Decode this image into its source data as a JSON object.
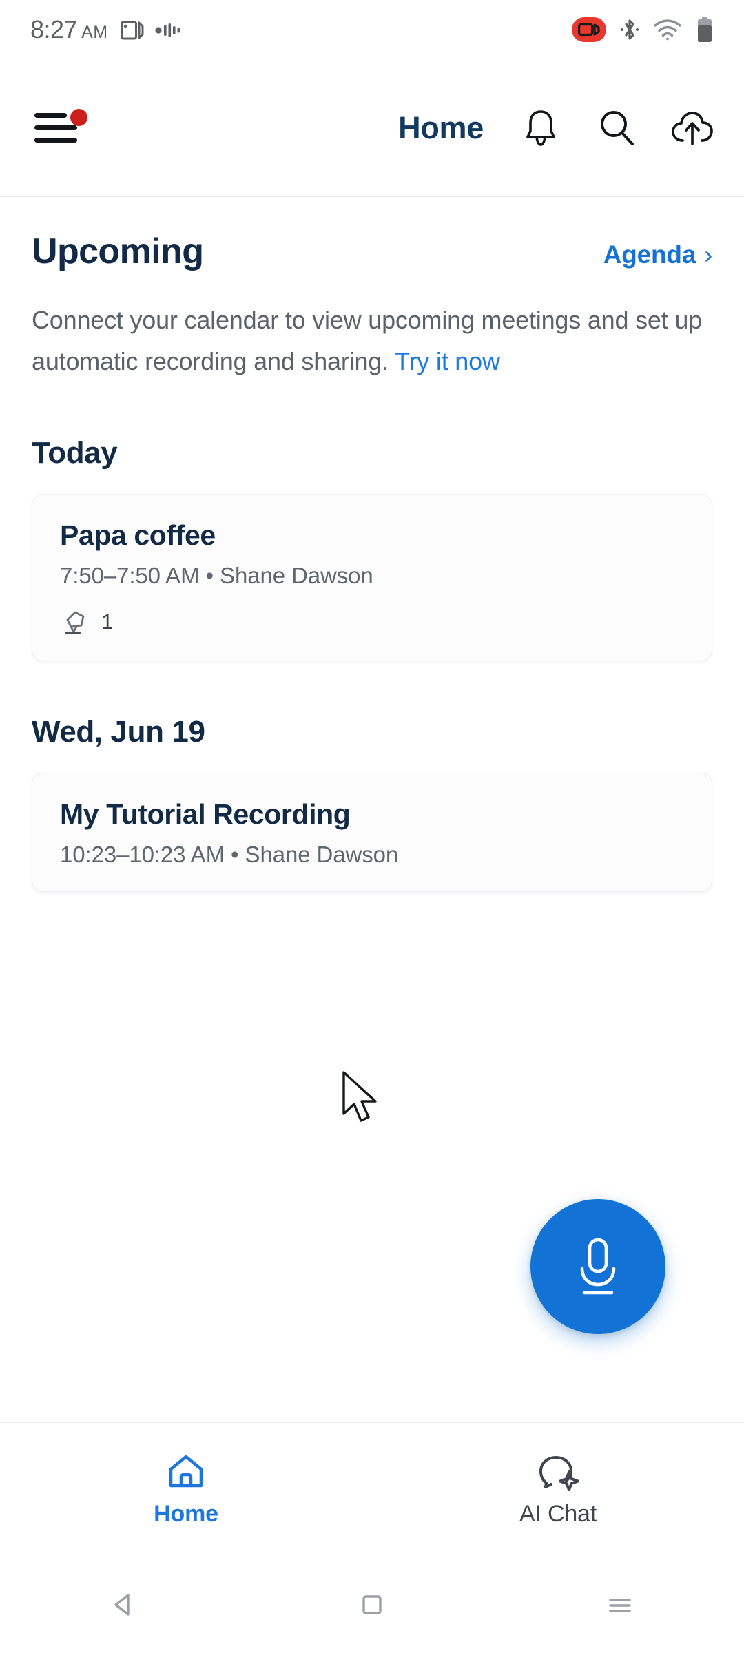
{
  "status_bar": {
    "time": "8:27",
    "ampm": "AM",
    "left_icons": [
      "screen-cast-icon",
      "sound-wave-icon"
    ],
    "right_icons": [
      "screen-recording-icon",
      "bluetooth-icon",
      "wifi-icon",
      "battery-icon"
    ],
    "recording_badge_color": "#e8372c",
    "text_color": "#5c6063"
  },
  "app_bar": {
    "menu_icon": "hamburger-menu-icon",
    "menu_badge": true,
    "badge_color": "#c9201c",
    "title": "Home",
    "title_color": "#14395e",
    "actions": [
      {
        "name": "notifications-icon",
        "label": "Notifications"
      },
      {
        "name": "search-icon",
        "label": "Search"
      },
      {
        "name": "cloud-upload-icon",
        "label": "Upload"
      }
    ]
  },
  "upcoming": {
    "heading": "Upcoming",
    "link_label": "Agenda",
    "link_chevron": "›",
    "link_color": "#1472d4",
    "body_text": "Connect your calendar to view upcoming meetings and set up automatic recording and sharing. ",
    "body_link": "Try it now",
    "body_link_color": "#1d7ae0"
  },
  "sections": [
    {
      "day_label": "Today",
      "items": [
        {
          "title": "Papa coffee",
          "subtitle": "7:50–7:50 AM  •  Shane Dawson",
          "meta_icon": "highlight-note-icon",
          "meta_count": "1"
        }
      ]
    },
    {
      "day_label": "Wed, Jun 19",
      "items": [
        {
          "title": "My Tutorial Recording",
          "subtitle": "10:23–10:23 AM  •  Shane Dawson",
          "meta_icon": null,
          "meta_count": null
        }
      ]
    }
  ],
  "fab": {
    "icon": "microphone-icon",
    "color": "#1272d6"
  },
  "bottom_nav": {
    "active_color": "#1c76dd",
    "inactive_color": "#3f464d",
    "items": [
      {
        "icon": "home-icon",
        "label": "Home",
        "active": true
      },
      {
        "icon": "ai-chat-icon",
        "label": "AI Chat",
        "active": false
      }
    ]
  },
  "system_nav": {
    "buttons": [
      "back-triangle-icon",
      "home-square-icon",
      "recents-lines-icon"
    ],
    "color": "#9aa0a6"
  },
  "cursor": {
    "icon": "mouse-pointer-icon"
  }
}
